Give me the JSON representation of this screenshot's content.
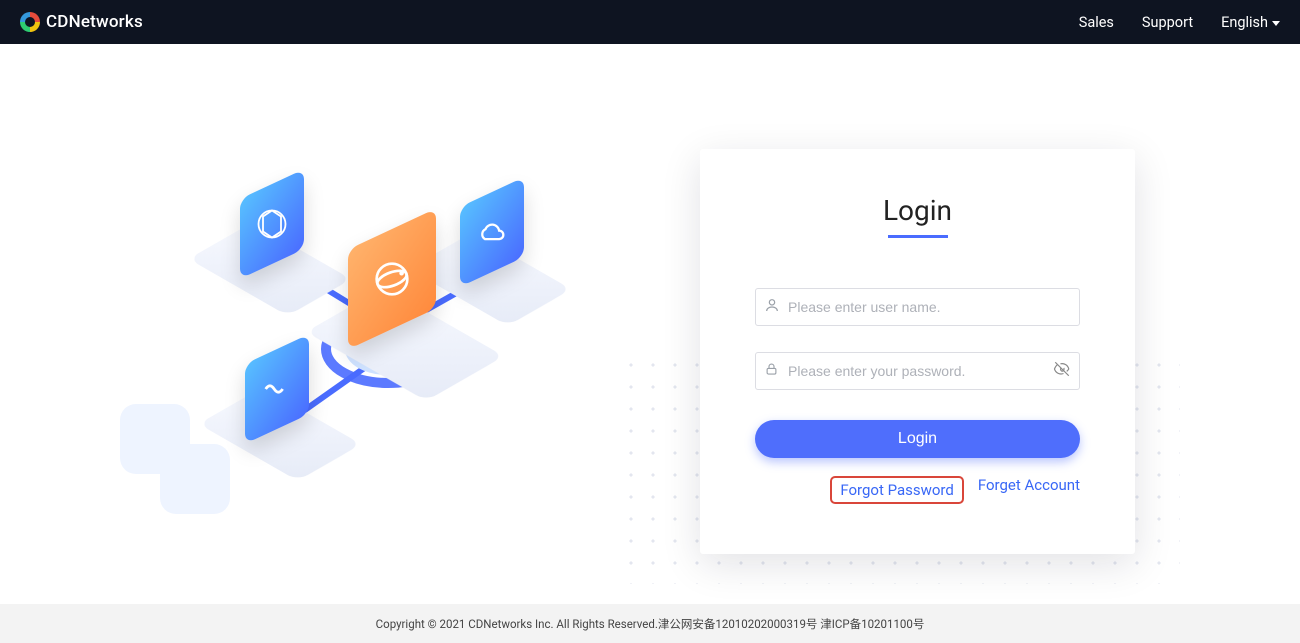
{
  "header": {
    "brand": "CDNetworks",
    "nav": {
      "sales": "Sales",
      "support": "Support",
      "language": "English"
    }
  },
  "login": {
    "title": "Login",
    "username_placeholder": "Please enter user name.",
    "password_placeholder": "Please enter your password.",
    "button": "Login",
    "forgot_password": "Forgot Password",
    "forget_account": "Forget Account"
  },
  "footer": {
    "text": "Copyright © 2021 CDNetworks Inc. All Rights Reserved.津公网安备12010202000319号 津ICP备10201100号"
  }
}
